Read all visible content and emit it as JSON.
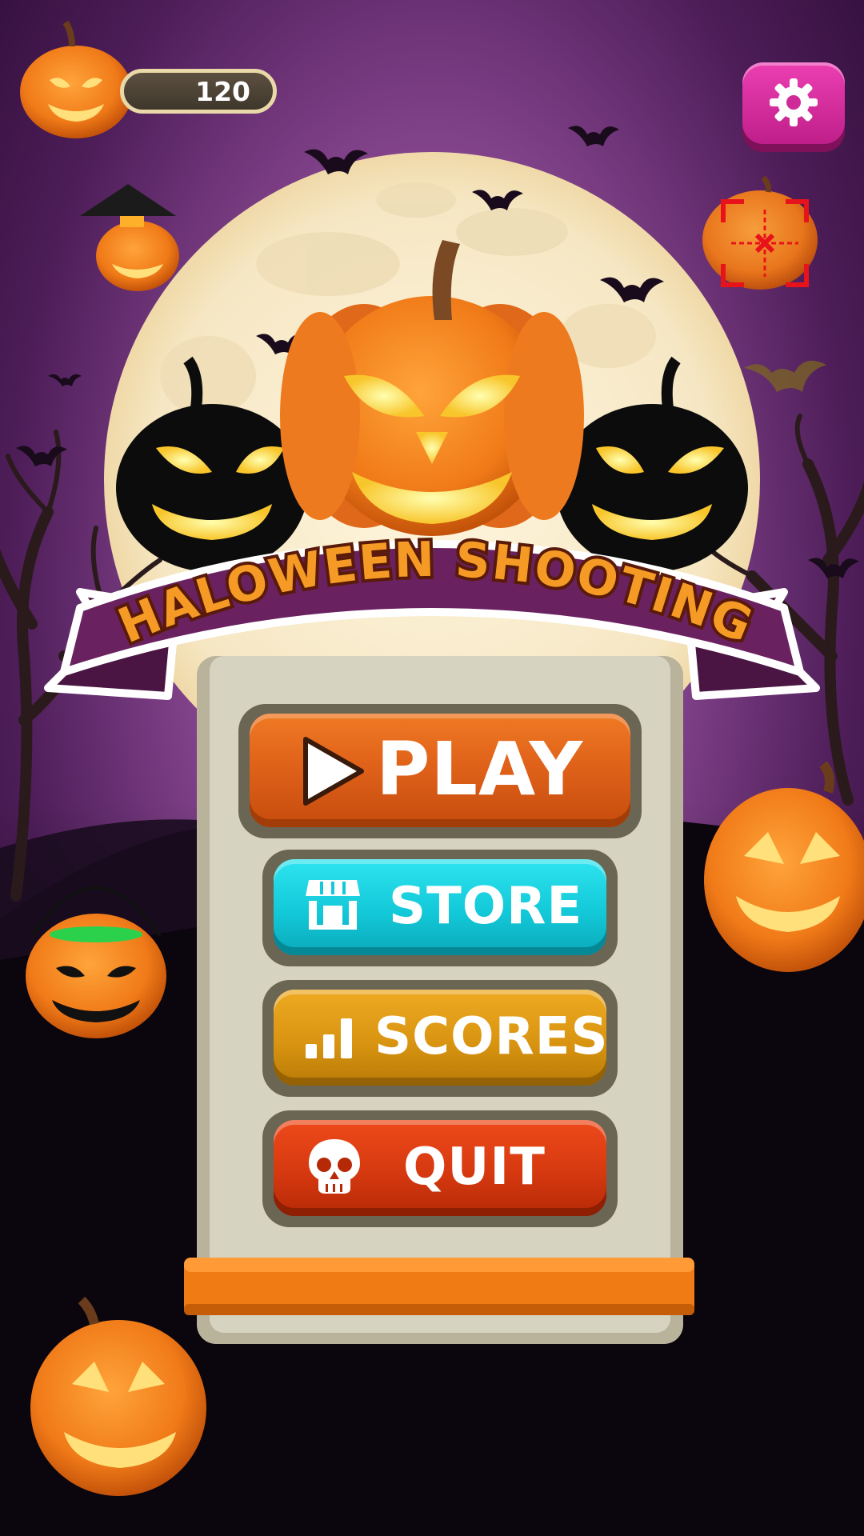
{
  "hud": {
    "score": "120",
    "score_icon": "pumpkin-icon",
    "settings_icon": "gear-icon",
    "crosshair_icon": "crosshair-target-icon"
  },
  "title": "HALOWEEN SHOOTING",
  "menu": {
    "play_label": "PLAY",
    "play_icon": "play-icon",
    "store_label": "STORE",
    "store_icon": "shop-icon",
    "scores_label": "SCORES",
    "scores_icon": "bar-chart-icon",
    "quit_label": "QUIT",
    "quit_icon": "skull-icon"
  },
  "colors": {
    "sky_top": "#2e0f3a",
    "sky_glow": "#8e4a9a",
    "moon": "#f7ecd0",
    "ribbon": "#6a2160",
    "title_fill": "#f59b25",
    "panel": "#d7d3c1",
    "play": "#e0621a",
    "store": "#13c9d9",
    "scores": "#d99511",
    "quit": "#d63910",
    "settings": "#d42e9e",
    "panel_base": "#f07a14"
  }
}
